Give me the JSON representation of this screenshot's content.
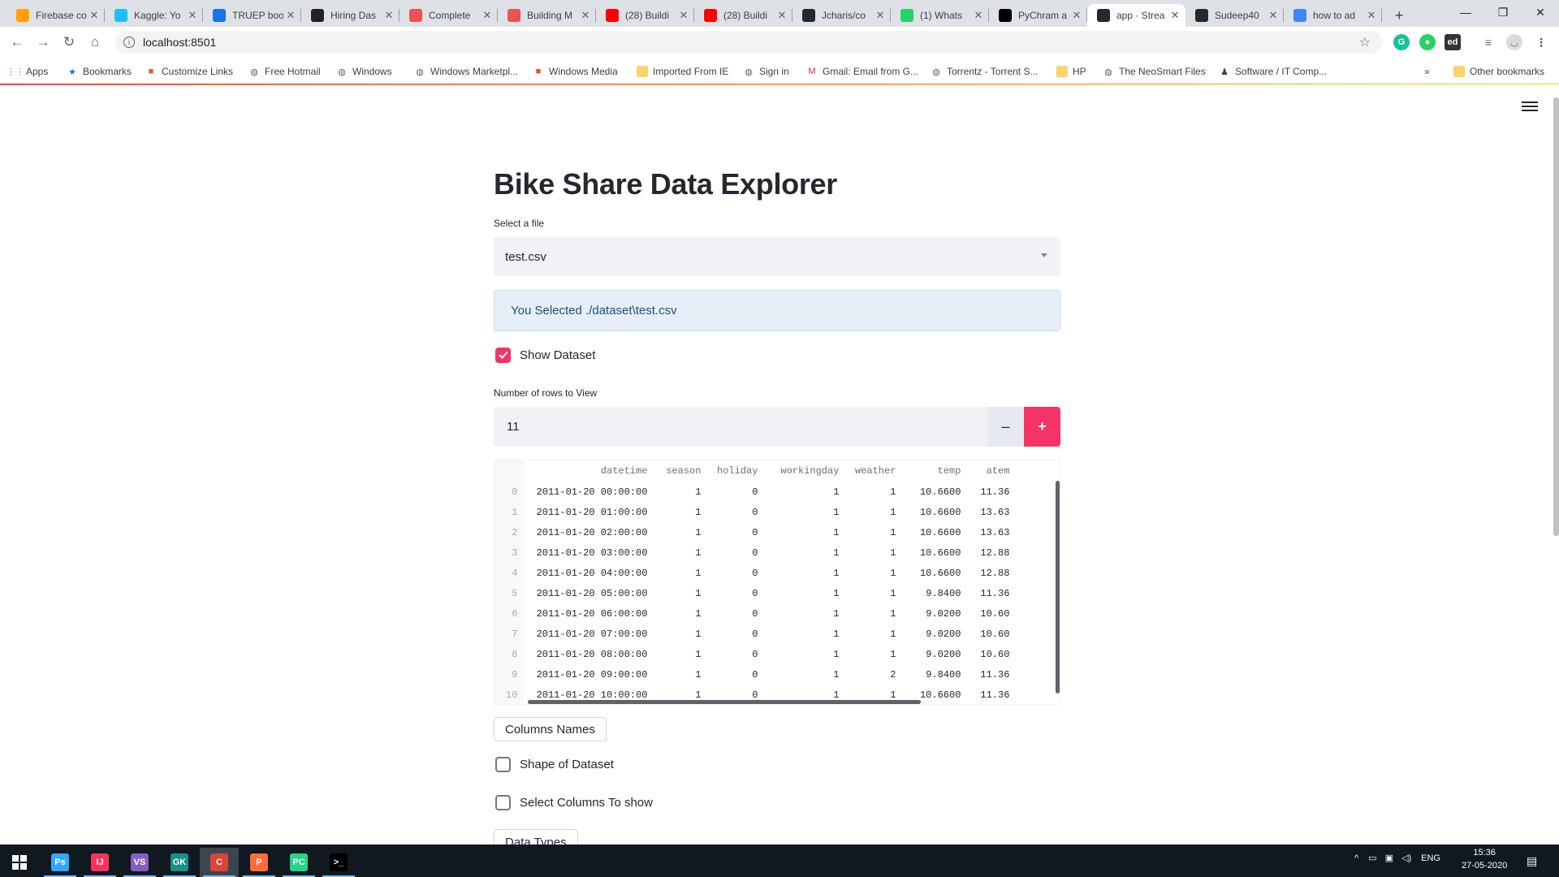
{
  "browser": {
    "tabs": [
      {
        "label": "Firebase co",
        "icon": "firebase-icon",
        "color": "#ffa000"
      },
      {
        "label": "Kaggle: Yo",
        "icon": "kaggle-icon",
        "color": "#20beff"
      },
      {
        "label": "TRUEP boo",
        "icon": "truep-icon",
        "color": "#1a73e8"
      },
      {
        "label": "Hiring Das",
        "icon": "edx-icon",
        "color": "#222222"
      },
      {
        "label": "Complete",
        "icon": "udemy-icon",
        "color": "#ec5252"
      },
      {
        "label": "Building M",
        "icon": "udemy-icon",
        "color": "#ec5252"
      },
      {
        "label": "(28) Buildi",
        "icon": "youtube-icon",
        "color": "#ff0000"
      },
      {
        "label": "(28) Buildi",
        "icon": "youtube-icon",
        "color": "#ff0000"
      },
      {
        "label": "Jcharis/co",
        "icon": "github-icon",
        "color": "#24292e"
      },
      {
        "label": "(1) Whats",
        "icon": "whatsapp-icon",
        "color": "#25d366"
      },
      {
        "label": "PyChram a",
        "icon": "pycharm-icon",
        "color": "#000000"
      },
      {
        "label": "app · Strea",
        "icon": "streamlit-icon",
        "color": "#262730",
        "active": true
      },
      {
        "label": "Sudeep40",
        "icon": "github-icon",
        "color": "#24292e"
      },
      {
        "label": "how to ad",
        "icon": "google-icon",
        "color": "#4285f4"
      }
    ],
    "new_tab": "+",
    "url": "localhost:8501",
    "bookmarks": [
      {
        "label": "Apps",
        "icon": "apps-grid-icon"
      },
      {
        "label": "Bookmarks",
        "icon": "star-icon"
      },
      {
        "label": "Customize Links",
        "icon": "windows-icon"
      },
      {
        "label": "Free Hotmail",
        "icon": "globe-icon"
      },
      {
        "label": "Windows",
        "icon": "globe-icon"
      },
      {
        "label": "Windows Marketpl...",
        "icon": "globe-icon"
      },
      {
        "label": "Windows Media",
        "icon": "windows-icon"
      },
      {
        "label": "Imported From IE",
        "icon": "folder-icon"
      },
      {
        "label": "Sign in",
        "icon": "globe-icon"
      },
      {
        "label": "Gmail: Email from G...",
        "icon": "gmail-icon"
      },
      {
        "label": "Torrentz - Torrent S...",
        "icon": "globe-icon"
      },
      {
        "label": "HP",
        "icon": "folder-icon"
      },
      {
        "label": "The NeoSmart Files",
        "icon": "globe-icon"
      },
      {
        "label": "Software / IT Comp...",
        "icon": "person-icon"
      }
    ],
    "bookmarks_overflow": "»",
    "other_bookmarks": "Other bookmarks"
  },
  "app": {
    "title": "Bike Share Data Explorer",
    "select_label": "Select a file",
    "selected_file": "test.csv",
    "info_message": "You Selected ./dataset\\test.csv",
    "show_dataset": {
      "label": "Show Dataset",
      "checked": true
    },
    "rows_label": "Number of rows to View",
    "rows_value": "11",
    "minus": "–",
    "plus": "+",
    "dataframe": {
      "columns": [
        "datetime",
        "season",
        "holiday",
        "workingday",
        "weather",
        "temp",
        "atem"
      ],
      "rows": [
        [
          "0",
          "2011-01-20 00:00:00",
          "1",
          "0",
          "1",
          "1",
          "10.6600",
          "11.36"
        ],
        [
          "1",
          "2011-01-20 01:00:00",
          "1",
          "0",
          "1",
          "1",
          "10.6600",
          "13.63"
        ],
        [
          "2",
          "2011-01-20 02:00:00",
          "1",
          "0",
          "1",
          "1",
          "10.6600",
          "13.63"
        ],
        [
          "3",
          "2011-01-20 03:00:00",
          "1",
          "0",
          "1",
          "1",
          "10.6600",
          "12.88"
        ],
        [
          "4",
          "2011-01-20 04:00:00",
          "1",
          "0",
          "1",
          "1",
          "10.6600",
          "12.88"
        ],
        [
          "5",
          "2011-01-20 05:00:00",
          "1",
          "0",
          "1",
          "1",
          "9.8400",
          "11.36"
        ],
        [
          "6",
          "2011-01-20 06:00:00",
          "1",
          "0",
          "1",
          "1",
          "9.0200",
          "10.60"
        ],
        [
          "7",
          "2011-01-20 07:00:00",
          "1",
          "0",
          "1",
          "1",
          "9.0200",
          "10.60"
        ],
        [
          "8",
          "2011-01-20 08:00:00",
          "1",
          "0",
          "1",
          "1",
          "9.0200",
          "10.60"
        ],
        [
          "9",
          "2011-01-20 09:00:00",
          "1",
          "0",
          "1",
          "2",
          "9.8400",
          "11.36"
        ],
        [
          "10",
          "2011-01-20 10:00:00",
          "1",
          "0",
          "1",
          "1",
          "10.6600",
          "11.36"
        ]
      ]
    },
    "columns_button": "Columns Names",
    "shape_checkbox": {
      "label": "Shape of Dataset",
      "checked": false
    },
    "select_columns_checkbox": {
      "label": "Select Columns To show",
      "checked": false
    },
    "data_types_button": "Data Types"
  },
  "taskbar": {
    "apps": [
      {
        "name": "photoshop-icon",
        "glyph": "Ps",
        "color": "#31a8ff"
      },
      {
        "name": "intellij-icon",
        "glyph": "IJ",
        "color": "#fe315d"
      },
      {
        "name": "visual-studio-icon",
        "glyph": "VS",
        "color": "#865fc5"
      },
      {
        "name": "gitkraken-icon",
        "glyph": "GK",
        "color": "#179287"
      },
      {
        "name": "chrome-icon",
        "glyph": "C",
        "color": "#db4437",
        "active": true
      },
      {
        "name": "postman-icon",
        "glyph": "P",
        "color": "#ff6c37"
      },
      {
        "name": "pycharm-icon",
        "glyph": "PC",
        "color": "#21d789"
      },
      {
        "name": "terminal-icon",
        "glyph": ">_",
        "color": "#000000"
      }
    ],
    "language": "ENG",
    "time": "15:36",
    "date": "27-05-2020"
  },
  "colors": {
    "accent": "#f63366",
    "info_bg": "#e6eff8",
    "widget_bg": "#f0f2f6"
  }
}
